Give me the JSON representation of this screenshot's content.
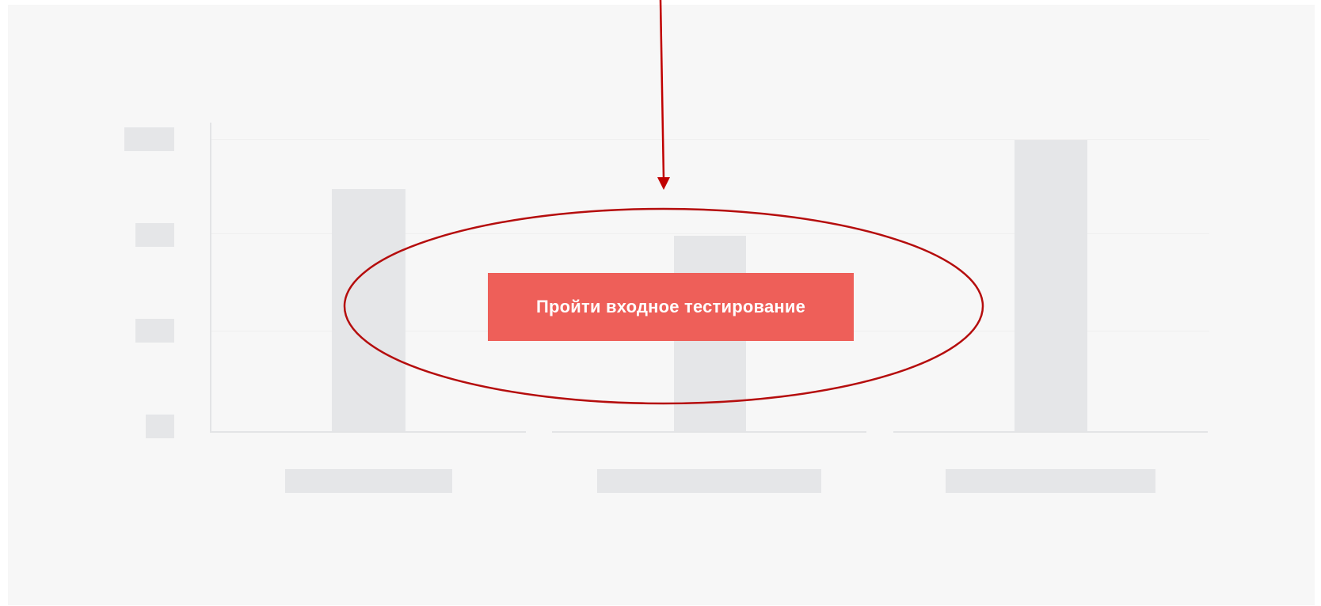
{
  "cta": {
    "label": "Пройти входное тестирование"
  },
  "colors": {
    "panel_background": "#f7f7f7",
    "placeholder": "#e5e6e8",
    "button": "#ee5f59",
    "button_text": "#ffffff",
    "annotation": "#c00000"
  },
  "placeholder_chart": {
    "bar_count": 3,
    "y_tick_count": 4,
    "grid": true
  }
}
